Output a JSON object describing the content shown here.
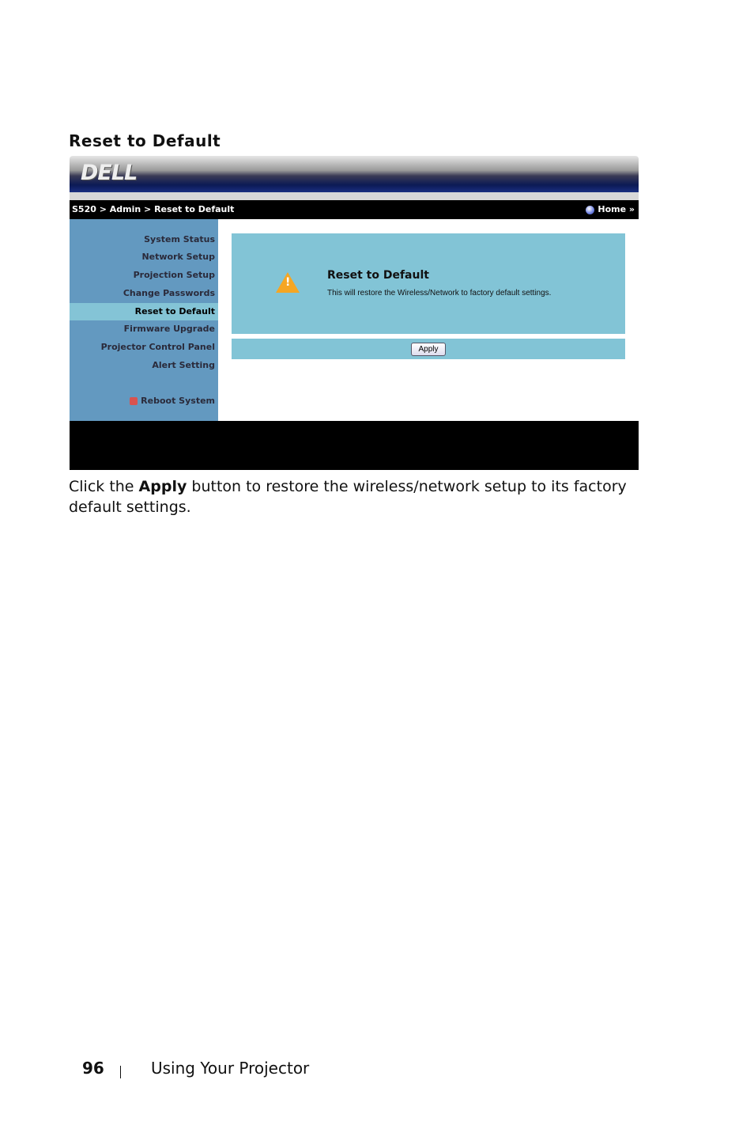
{
  "heading": "Reset to Default",
  "screenshot": {
    "logo": "DELL",
    "breadcrumb": "S520 > Admin > Reset to Default",
    "home_link": "Home »",
    "sidebar": [
      "System Status",
      "Network Setup",
      "Projection Setup",
      "Change Passwords",
      "Reset to Default",
      "Firmware Upgrade",
      "Projector Control Panel",
      "Alert Setting"
    ],
    "active_item": "Reset to Default",
    "reboot": "Reboot System",
    "panel_title": "Reset to Default",
    "panel_text": "This will restore the Wireless/Network to factory default settings.",
    "apply_label": "Apply",
    "colors": {
      "sidebar": "#6399c0",
      "active": "#84c4d6",
      "panel": "#82c4d6"
    }
  },
  "body": {
    "pre": "Click the ",
    "bold": "Apply",
    "post": " button to restore the wireless/network setup to its factory default settings."
  },
  "footer": {
    "page_number": "96",
    "section": "Using Your Projector"
  }
}
